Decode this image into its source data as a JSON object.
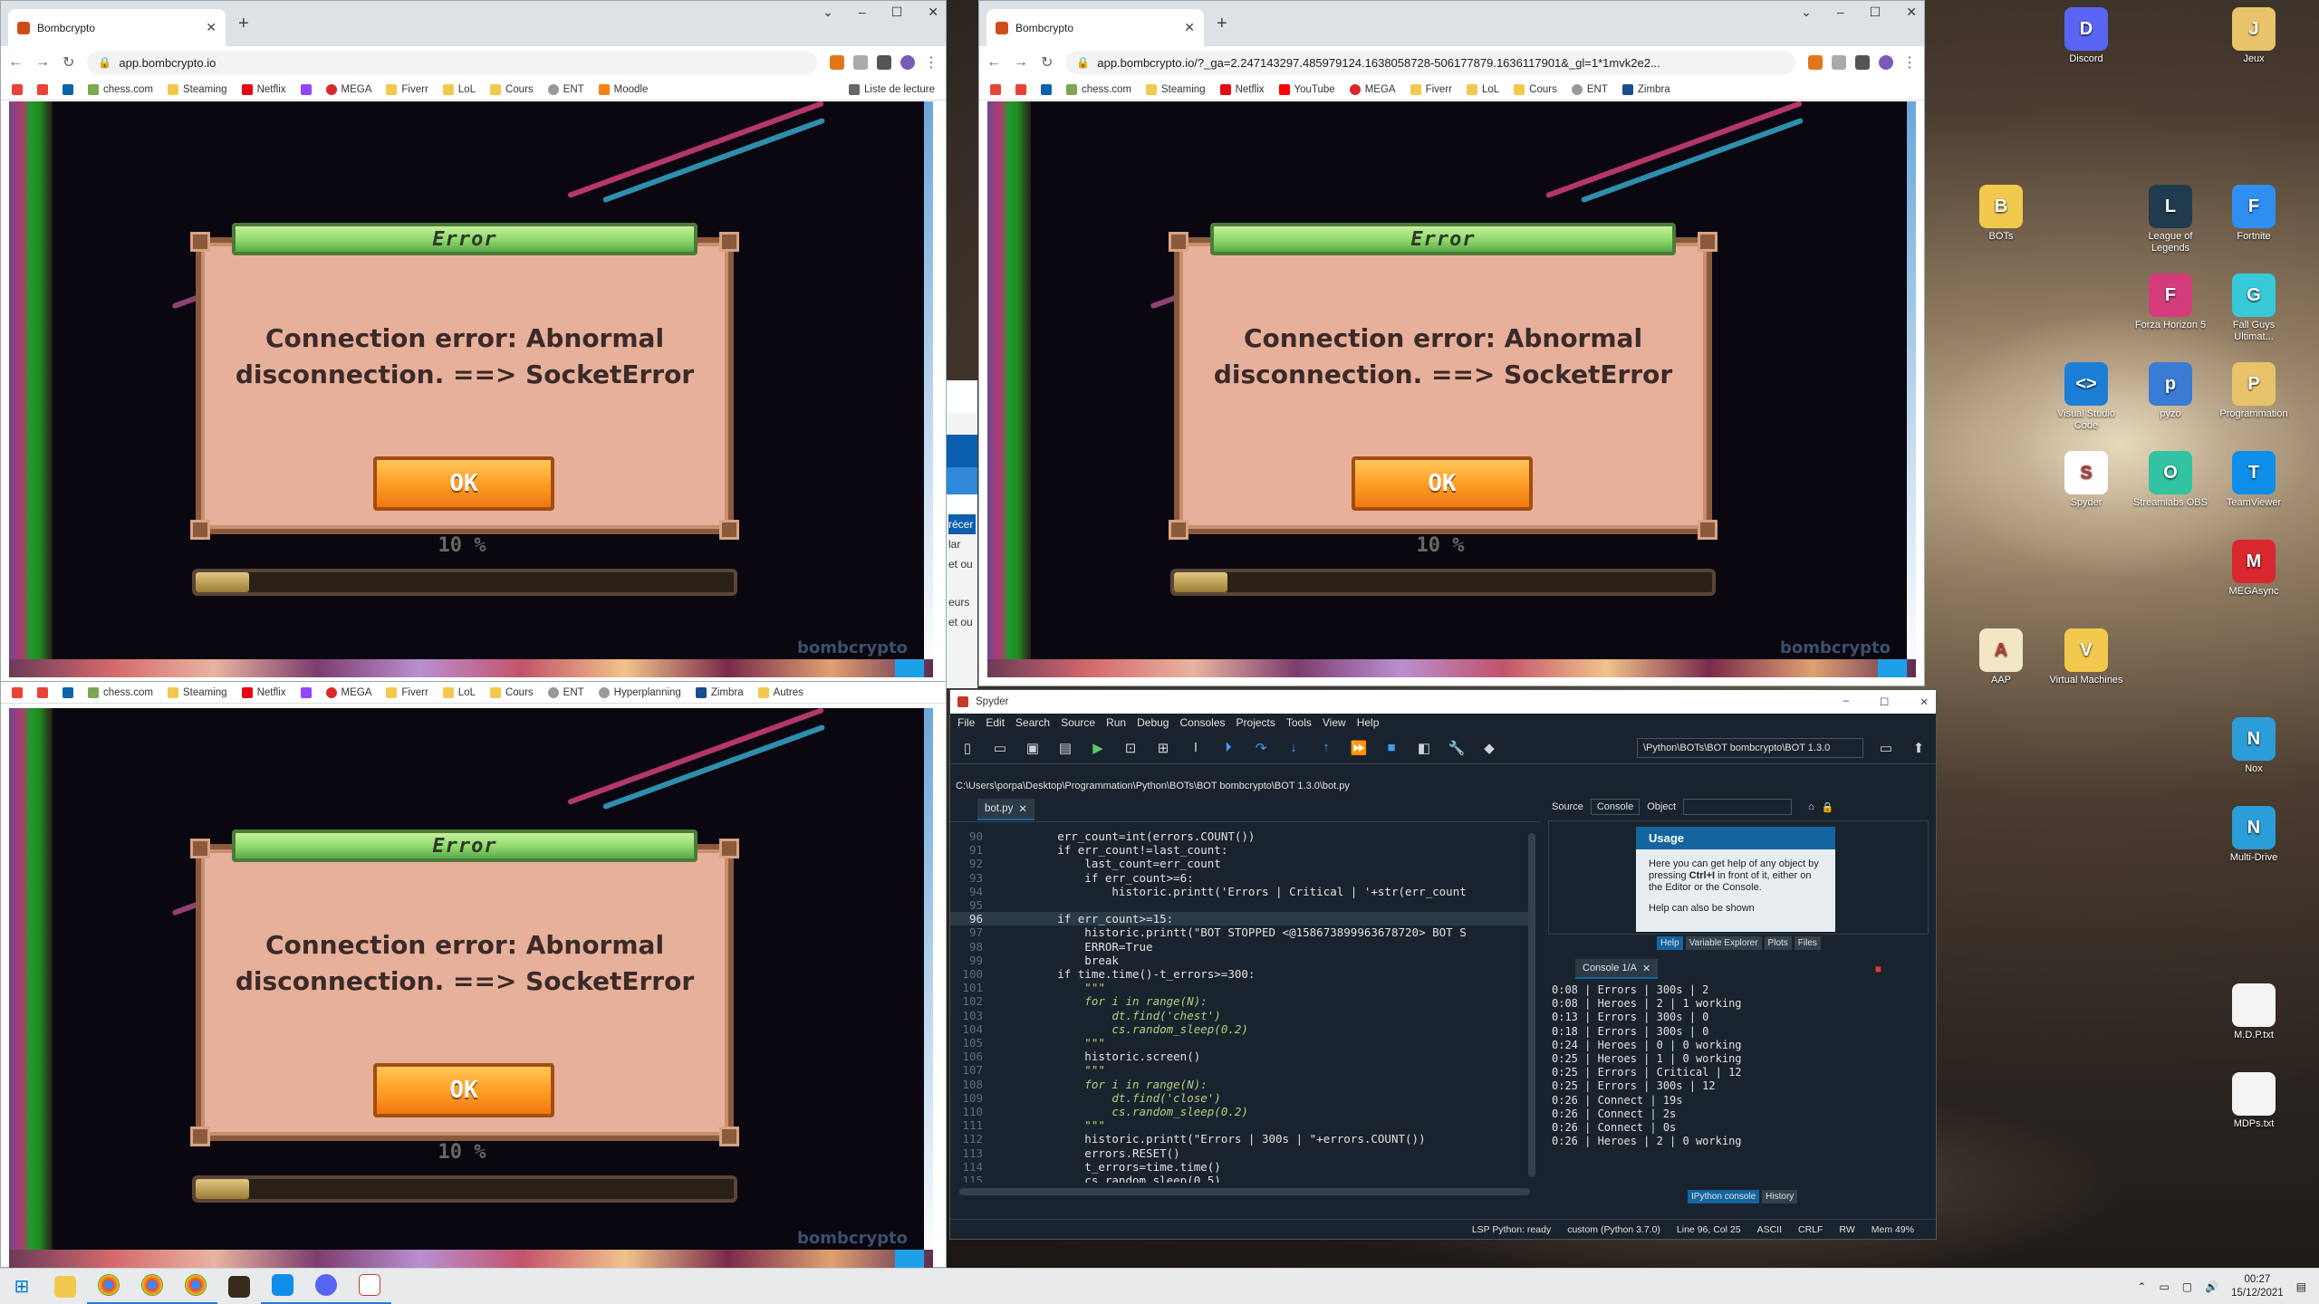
{
  "browser1": {
    "tab_title": "Bombcrypto",
    "url": "app.bombcrypto.io",
    "bookmarks": [
      "chess.com",
      "Steaming",
      "Netflix",
      "MEGA",
      "Fiverr",
      "LoL",
      "Cours",
      "ENT",
      "Moodle"
    ],
    "reading_list": "Liste de lecture"
  },
  "browser2": {
    "tab_title": "Bombcrypto",
    "url": "app.bombcrypto.io/?_ga=2.247143297.485979124.1638058728-506177879.1636117901&_gl=1*1mvk2e2...",
    "bookmarks": [
      "chess.com",
      "Steaming",
      "Netflix",
      "YouTube",
      "MEGA",
      "Fiverr",
      "LoL",
      "Cours",
      "ENT",
      "Zimbra"
    ]
  },
  "browser3": {
    "bookmarks": [
      "chess.com",
      "Steaming",
      "Netflix",
      "MEGA",
      "Fiverr",
      "LoL",
      "Cours",
      "ENT",
      "Hyperplanning",
      "Zimbra",
      "Autres"
    ]
  },
  "game": {
    "dialog_title": "Error",
    "message_line1": "Connection error: Abnormal",
    "message_line2": "disconnection. ==> SocketError",
    "ok_label": "OK",
    "progress_label": "10 %",
    "progress": 0.1,
    "watermark": "bombcrypto"
  },
  "midwin": {
    "texts": [
      "récer",
      "lar",
      "et ou",
      "eurs",
      "et ou"
    ]
  },
  "spyder": {
    "title": "Spyder",
    "menu": [
      "File",
      "Edit",
      "Search",
      "Source",
      "Run",
      "Debug",
      "Consoles",
      "Projects",
      "Tools",
      "View",
      "Help"
    ],
    "workdir": "\\Python\\BOTs\\BOT bombcrypto\\BOT 1.3.0",
    "filepath": "C:\\Users\\porpa\\Desktop\\Programmation\\Python\\BOTs\\BOT bombcrypto\\BOT 1.3.0\\bot.py",
    "editor_tab": "bot.py",
    "code_lines": [
      {
        "n": "90",
        "t": "        err_count=int(errors.COUNT())",
        "k": ""
      },
      {
        "n": "91",
        "t": "        if err_count!=last_count:",
        "k": ""
      },
      {
        "n": "92",
        "t": "            last_count=err_count",
        "k": ""
      },
      {
        "n": "93",
        "t": "            if err_count>=6:",
        "k": ""
      },
      {
        "n": "94",
        "t": "                historic.printt('Errors | Critical | '+str(err_count",
        "k": ""
      },
      {
        "n": "95",
        "t": "",
        "k": ""
      },
      {
        "n": "96",
        "t": "        if err_count>=15:",
        "k": "cur"
      },
      {
        "n": "97",
        "t": "            historic.printt(\"BOT STOPPED <@158673899963678720> BOT S",
        "k": ""
      },
      {
        "n": "98",
        "t": "            ERROR=True",
        "k": ""
      },
      {
        "n": "99",
        "t": "            break",
        "k": ""
      },
      {
        "n": "100",
        "t": "        if time.time()-t_errors>=300:",
        "k": ""
      },
      {
        "n": "101",
        "t": "            \"\"\"",
        "k": "str"
      },
      {
        "n": "102",
        "t": "            for i in range(N):",
        "k": "str"
      },
      {
        "n": "103",
        "t": "                dt.find('chest')",
        "k": "str"
      },
      {
        "n": "104",
        "t": "                cs.random_sleep(0.2)",
        "k": "str"
      },
      {
        "n": "105",
        "t": "            \"\"\"",
        "k": "str"
      },
      {
        "n": "106",
        "t": "            historic.screen()",
        "k": ""
      },
      {
        "n": "107",
        "t": "            \"\"\"",
        "k": "str"
      },
      {
        "n": "108",
        "t": "            for i in range(N):",
        "k": "str"
      },
      {
        "n": "109",
        "t": "                dt.find('close')",
        "k": "str"
      },
      {
        "n": "110",
        "t": "                cs.random_sleep(0.2)",
        "k": "str"
      },
      {
        "n": "111",
        "t": "            \"\"\"",
        "k": "str"
      },
      {
        "n": "112",
        "t": "            historic.printt(\"Errors | 300s | \"+errors.COUNT())",
        "k": ""
      },
      {
        "n": "113",
        "t": "            errors.RESET()",
        "k": ""
      },
      {
        "n": "114",
        "t": "            t_errors=time.time()",
        "k": ""
      },
      {
        "n": "115",
        "t": "            cs.random_sleep(0.5)",
        "k": ""
      },
      {
        "n": "116",
        "t": "    if ERROR:",
        "k": ""
      }
    ],
    "help_source_label": "Source",
    "help_source_value": "Console",
    "help_object_label": "Object",
    "usage_title": "Usage",
    "usage_text1": "Here you can get help of any object by pressing ",
    "usage_key": "Ctrl+I",
    "usage_text2": " in front of it, either on the Editor or the Console.",
    "usage_text3": "Help can also be shown",
    "pane_tabs": [
      "Help",
      "Variable Explorer",
      "Plots",
      "Files"
    ],
    "console_tab": "Console 1/A",
    "console_lines": [
      "0:08 | Errors | 300s | 2",
      "0:08 | Heroes | 2 | 1 working",
      "0:13 | Errors | 300s | 0",
      "0:18 | Errors | 300s | 0",
      "0:24 | Heroes | 0 | 0 working",
      "0:25 | Heroes | 1 | 0 working",
      "0:25 | Errors | Critical | 12",
      "0:25 | Errors | 300s | 12",
      "0:26 | Connect | 19s",
      "0:26 | Connect | 2s",
      "0:26 | Connect | 0s",
      "0:26 | Heroes | 2 | 0 working"
    ],
    "bottom_tabs": [
      "IPython console",
      "History"
    ],
    "status": [
      "LSP Python: ready",
      "custom (Python 3.7.0)",
      "Line 96, Col 25",
      "ASCII",
      "CRLF",
      "RW",
      "Mem 49%"
    ]
  },
  "desktop_icons": [
    {
      "label": "Discord",
      "color": "#5865f2",
      "glyph": "D"
    },
    {
      "label": "Jeux",
      "color": "#e8c36a",
      "glyph": "J"
    },
    {
      "label": "BOTs",
      "color": "#f2c94c",
      "glyph": "B"
    },
    {
      "label": "League of Legends",
      "color": "#1f3b4d",
      "glyph": "L"
    },
    {
      "label": "Fortnite",
      "color": "#2f8ff0",
      "glyph": "F"
    },
    {
      "label": "Forza Horizon 5",
      "color": "#d43c7b",
      "glyph": "F"
    },
    {
      "label": "Fall Guys Ultimat...",
      "color": "#38c9d9",
      "glyph": "G"
    },
    {
      "label": "Visual Studio Code",
      "color": "#1c7ed6",
      "glyph": "<>"
    },
    {
      "label": "pyzo",
      "color": "#3a7bd5",
      "glyph": "p"
    },
    {
      "label": "Programmation",
      "color": "#e8c36a",
      "glyph": "P"
    },
    {
      "label": "Spyder",
      "color": "#ffffff",
      "glyph": "S"
    },
    {
      "label": "Streamlabs OBS",
      "color": "#31c3a2",
      "glyph": "O"
    },
    {
      "label": "TeamViewer",
      "color": "#0e8ee9",
      "glyph": "T"
    },
    {
      "label": "MEGAsync",
      "color": "#d9272e",
      "glyph": "M"
    },
    {
      "label": "AAP",
      "color": "#f2e6c4",
      "glyph": "A"
    },
    {
      "label": "Virtual Machines",
      "color": "#f2c94c",
      "glyph": "V"
    },
    {
      "label": "Nox",
      "color": "#2b9dd8",
      "glyph": "N"
    },
    {
      "label": "Multi-Drive",
      "color": "#2b9dd8",
      "glyph": "N"
    },
    {
      "label": "M.D.P.txt",
      "color": "#f4f4f4",
      "glyph": ""
    },
    {
      "label": "MDPs.txt",
      "color": "#f4f4f4",
      "glyph": ""
    }
  ],
  "taskbar": {
    "time": "00:27",
    "date": "15/12/2021"
  }
}
